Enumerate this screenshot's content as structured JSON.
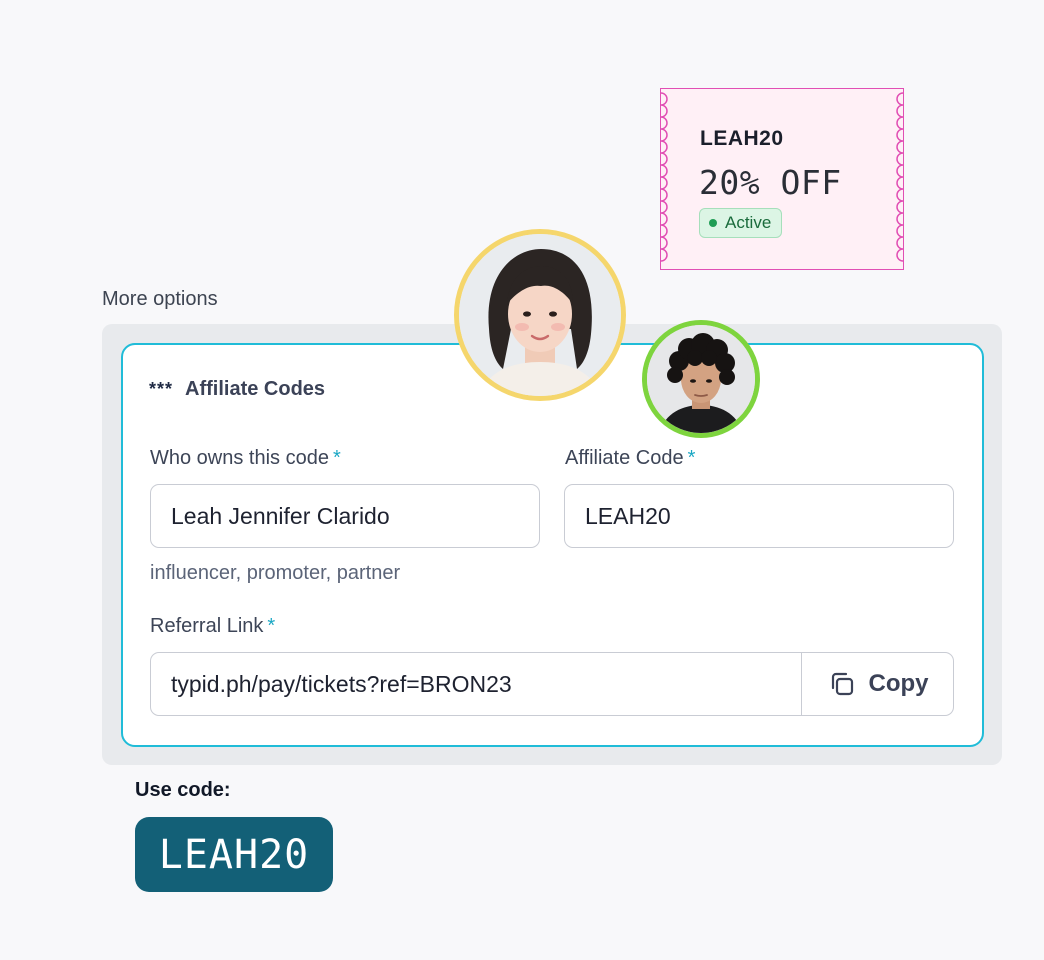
{
  "coupon": {
    "code": "LEAH20",
    "discount": "20% OFF",
    "status": "Active"
  },
  "more_options": {
    "label": "More options"
  },
  "affiliate_card": {
    "icon": "asterisks-icon",
    "icon_glyph": "***",
    "title": "Affiliate Codes",
    "owner_field": {
      "label": "Who owns this code",
      "required_mark": "*",
      "value": "Leah Jennifer Clarido",
      "hint": "influencer, promoter, partner"
    },
    "code_field": {
      "label": "Affiliate Code",
      "required_mark": "*",
      "value": "LEAH20"
    },
    "referral_field": {
      "label": "Referral Link",
      "required_mark": "*",
      "value": "typid.ph/pay/tickets?ref=BRON23",
      "copy_label": "Copy"
    }
  },
  "use_code": {
    "label": "Use code:",
    "code": "LEAH20"
  },
  "colors": {
    "accent_cyan": "#20bcd8",
    "coupon_pink": "#e14fb4",
    "active_green": "#1f9d55",
    "code_badge_teal": "#136077",
    "avatar_ring_yellow": "#f5d66c",
    "avatar_ring_green": "#7ed43e"
  }
}
